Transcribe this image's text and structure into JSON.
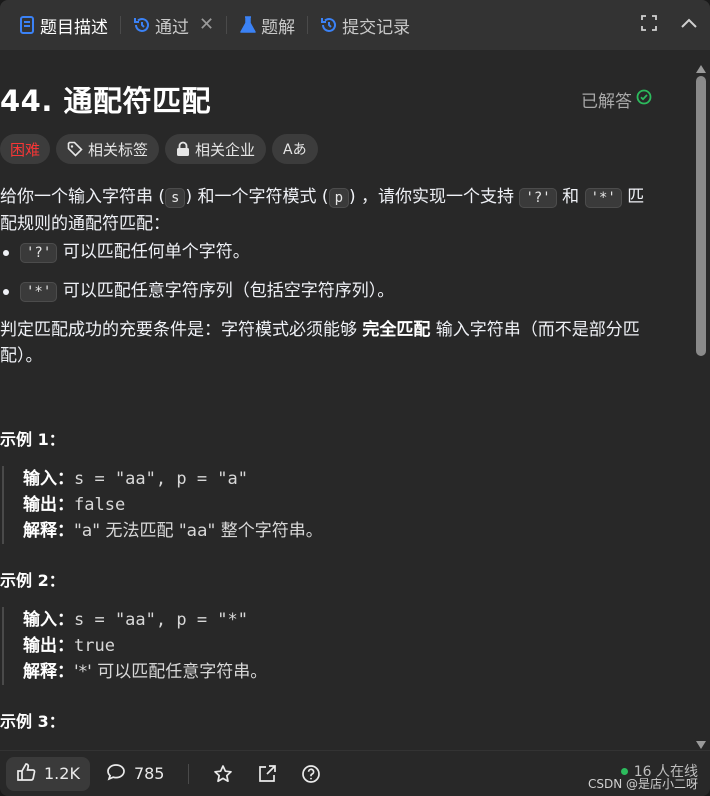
{
  "tabs": [
    {
      "label": "题目描述",
      "icon": "document-icon"
    },
    {
      "label": "通过",
      "icon": "history-icon"
    },
    {
      "label": "题解",
      "icon": "flask-icon"
    },
    {
      "label": "提交记录",
      "icon": "history-icon"
    }
  ],
  "problem": {
    "title": "44. 通配符匹配",
    "status": "已解答",
    "tags": [
      "困难",
      "相关标签",
      "相关企业",
      "Aあ"
    ]
  },
  "description": {
    "p1_a": "给你一个输入字符串 (",
    "p1_s": "s",
    "p1_b": ") 和一个字符模式 (",
    "p1_p": "p",
    "p1_c": ") ，请你实现一个支持 ",
    "p1_q": "'?'",
    "p1_d": " 和 ",
    "p1_star": "'*'",
    "p1_e": " 匹配规则的通配符匹配：",
    "b1_code": "'?'",
    "b1_text": " 可以匹配任何单个字符。",
    "b2_code": "'*'",
    "b2_text": " 可以匹配任意字符序列（包括空字符序列）。",
    "p2_a": "判定匹配成功的充要条件是：字符模式必须能够 ",
    "p2_strong": "完全匹配",
    "p2_b": " 输入字符串（而不是部分匹配）。"
  },
  "examples": [
    {
      "heading": "示例 1：",
      "input_label": "输入：",
      "input": "s = \"aa\", p = \"a\"",
      "output_label": "输出：",
      "output": "false",
      "explain_label": "解释：",
      "explain": "\"a\" 无法匹配 \"aa\" 整个字符串。"
    },
    {
      "heading": "示例 2：",
      "input_label": "输入：",
      "input": "s = \"aa\", p = \"*\"",
      "output_label": "输出：",
      "output": "true",
      "explain_label": "解释：",
      "explain": "'*' 可以匹配任意字符串。"
    },
    {
      "heading": "示例 3："
    }
  ],
  "footer": {
    "likes": "1.2K",
    "comments": "785",
    "online": "16 人在线",
    "watermark": "CSDN @是店小二呀"
  },
  "colors": {
    "hard": "#f63636",
    "solved_check": "#2cbb5d",
    "accent_tab_icon": "#3b82f6"
  }
}
